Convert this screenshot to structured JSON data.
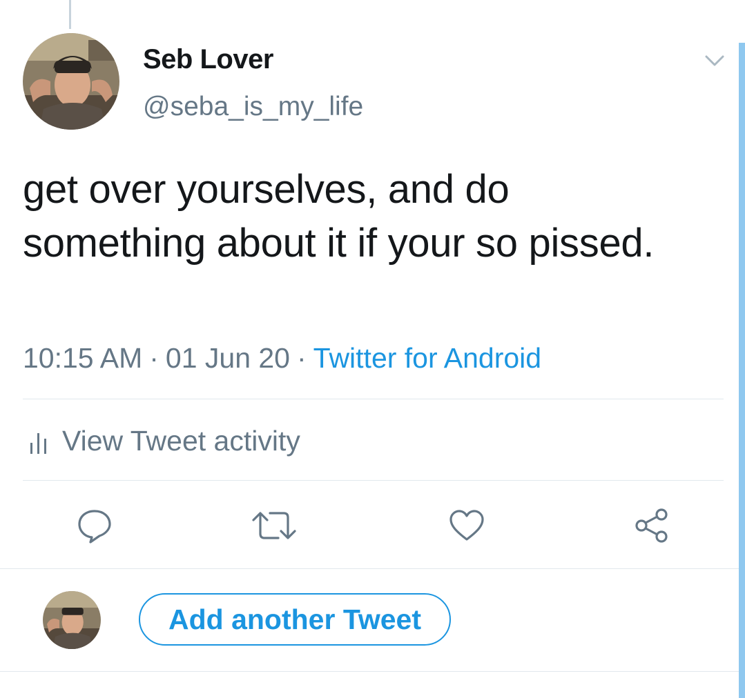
{
  "tweet": {
    "display_name": "Seb Lover",
    "handle": "@seba_is_my_life",
    "text": "get over yourselves, and do something about it if your so pissed.",
    "time": "10:15 AM",
    "date": "01 Jun 20",
    "source": "Twitter for Android",
    "separator": "·"
  },
  "activity": {
    "label": "View Tweet activity"
  },
  "actions": {
    "reply_icon": "reply-icon",
    "retweet_icon": "retweet-icon",
    "like_icon": "heart-icon",
    "share_icon": "share-icon"
  },
  "composer": {
    "add_tweet_label": "Add another Tweet"
  },
  "colors": {
    "accent": "#1b95e0",
    "muted": "#657786",
    "text": "#14171a",
    "divider": "#e1e8ed"
  }
}
